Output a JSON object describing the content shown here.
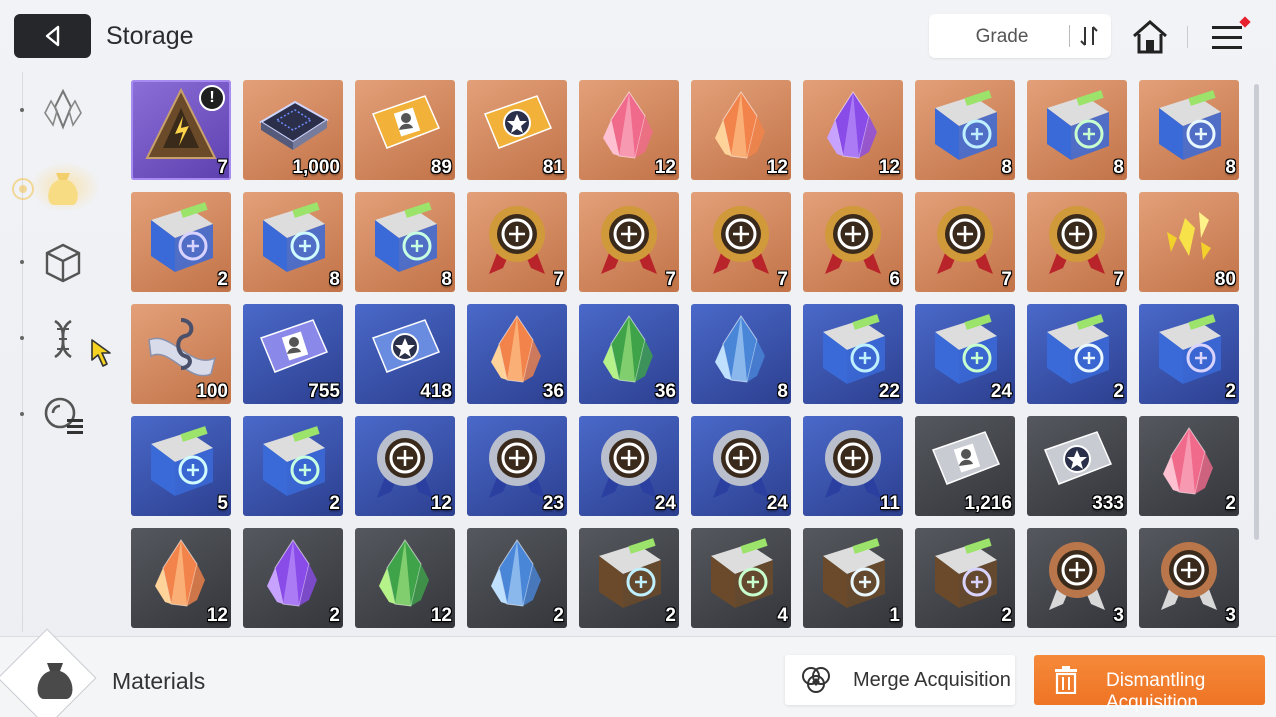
{
  "header": {
    "title": "Storage",
    "sort": {
      "label": "Grade"
    }
  },
  "sidebar": {
    "items": [
      {
        "name": "crystal",
        "icon": "crystal-icon"
      },
      {
        "name": "materials",
        "icon": "bag-icon",
        "active": true
      },
      {
        "name": "box",
        "icon": "cube-icon"
      },
      {
        "name": "dna",
        "icon": "dna-icon"
      },
      {
        "name": "badge-list",
        "icon": "badge-list-icon"
      }
    ]
  },
  "inventory": {
    "rows": [
      [
        {
          "icon": "triangle-core-icon",
          "tier": "purple",
          "count": "7",
          "alert": true
        },
        {
          "icon": "chip-icon",
          "tier": "orange",
          "count": "1,000"
        },
        {
          "icon": "profile-ticket-icon",
          "tier": "orange",
          "count": "89"
        },
        {
          "icon": "star-ticket-icon",
          "tier": "orange",
          "count": "81"
        },
        {
          "icon": "pink-crystal-icon",
          "tier": "orange",
          "count": "12"
        },
        {
          "icon": "orange-crystal-icon",
          "tier": "orange",
          "count": "12"
        },
        {
          "icon": "purple-crystal-icon",
          "tier": "orange",
          "count": "12"
        },
        {
          "icon": "sword-book-icon",
          "tier": "orange",
          "count": "8"
        },
        {
          "icon": "shield-book-icon",
          "tier": "orange",
          "count": "8"
        },
        {
          "icon": "eye-book-icon",
          "tier": "orange",
          "count": "8"
        }
      ],
      [
        {
          "icon": "wing-book-icon",
          "tier": "orange",
          "count": "2"
        },
        {
          "icon": "bolt-book-icon",
          "tier": "orange",
          "count": "8"
        },
        {
          "icon": "orb-book-icon",
          "tier": "orange",
          "count": "8"
        },
        {
          "icon": "cross-medal-icon",
          "tier": "orange",
          "count": "7"
        },
        {
          "icon": "shield-medal-icon",
          "tier": "orange",
          "count": "7"
        },
        {
          "icon": "eye-medal-icon",
          "tier": "orange",
          "count": "7"
        },
        {
          "icon": "wing-medal-icon",
          "tier": "orange",
          "count": "6"
        },
        {
          "icon": "bolt-medal-icon",
          "tier": "orange",
          "count": "7"
        },
        {
          "icon": "orb-medal-icon",
          "tier": "orange",
          "count": "7"
        },
        {
          "icon": "gold-shards-icon",
          "tier": "orange",
          "count": "80"
        }
      ],
      [
        {
          "icon": "music-scroll-icon",
          "tier": "orange",
          "count": "100"
        },
        {
          "icon": "profile-ticket-icon",
          "tier": "blue",
          "count": "755"
        },
        {
          "icon": "star-ticket-icon",
          "tier": "blue",
          "count": "418"
        },
        {
          "icon": "orange-crystal-icon",
          "tier": "blue",
          "count": "36"
        },
        {
          "icon": "green-crystal-icon",
          "tier": "blue",
          "count": "36"
        },
        {
          "icon": "blue-crystal-icon",
          "tier": "blue",
          "count": "8"
        },
        {
          "icon": "sword-book-icon",
          "tier": "blue",
          "count": "22"
        },
        {
          "icon": "shield-book-icon",
          "tier": "blue",
          "count": "24"
        },
        {
          "icon": "eye-book-icon",
          "tier": "blue",
          "count": "2"
        },
        {
          "icon": "wing-book-icon",
          "tier": "blue",
          "count": "2"
        }
      ],
      [
        {
          "icon": "bolt-book-icon",
          "tier": "blue",
          "count": "5"
        },
        {
          "icon": "orb-book-icon",
          "tier": "blue",
          "count": "2"
        },
        {
          "icon": "cross-medal-icon",
          "tier": "blue",
          "count": "12"
        },
        {
          "icon": "shield-medal-icon",
          "tier": "blue",
          "count": "23"
        },
        {
          "icon": "eye-medal-icon",
          "tier": "blue",
          "count": "24"
        },
        {
          "icon": "bolt-medal-icon",
          "tier": "blue",
          "count": "24"
        },
        {
          "icon": "orb-medal-icon",
          "tier": "blue",
          "count": "11"
        },
        {
          "icon": "profile-ticket-icon",
          "tier": "gray",
          "count": "1,216"
        },
        {
          "icon": "star-ticket-icon",
          "tier": "gray",
          "count": "333"
        },
        {
          "icon": "pink-crystal-icon",
          "tier": "gray",
          "count": "2"
        }
      ],
      [
        {
          "icon": "orange-crystal-icon",
          "tier": "gray",
          "count": "12"
        },
        {
          "icon": "purple-crystal-icon",
          "tier": "gray",
          "count": "2"
        },
        {
          "icon": "green-crystal-icon",
          "tier": "gray",
          "count": "12"
        },
        {
          "icon": "blue-crystal-icon",
          "tier": "gray",
          "count": "2"
        },
        {
          "icon": "sword-book-icon",
          "tier": "brown",
          "count": "2"
        },
        {
          "icon": "shield-book-icon",
          "tier": "brown",
          "count": "4"
        },
        {
          "icon": "eye-book-icon",
          "tier": "brown",
          "count": "1"
        },
        {
          "icon": "wing-book-icon",
          "tier": "brown",
          "count": "2"
        },
        {
          "icon": "eye-medal-icon",
          "tier": "bronze",
          "count": "3"
        },
        {
          "icon": "bolt-medal-icon",
          "tier": "bronze",
          "count": "3"
        }
      ]
    ]
  },
  "footer": {
    "category": "Materials",
    "merge_label": "Merge Acquisition",
    "dismantle_label": "Dismantling Acquisition"
  },
  "colors": {
    "accent": "#ee7424",
    "tier_purple": "#6a4cc0",
    "tier_orange": "#d18a60",
    "tier_blue": "#3a55b0",
    "tier_gray": "#45474c"
  }
}
